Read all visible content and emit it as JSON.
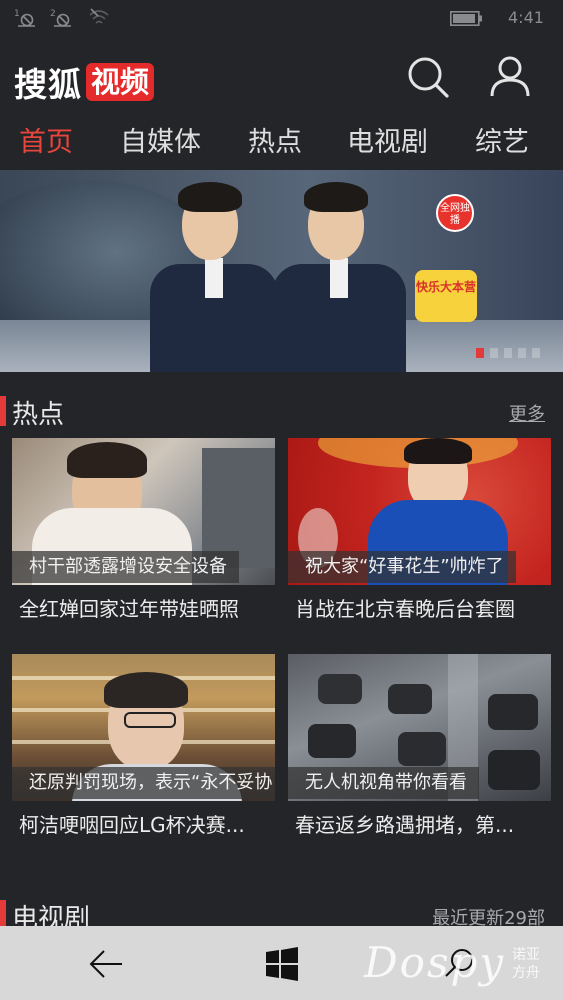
{
  "status_bar": {
    "sim1_label": "1",
    "sim2_label": "2",
    "time": "4:41"
  },
  "header": {
    "logo_text": "搜狐",
    "logo_badge": "视频",
    "search_icon": "search-icon",
    "user_icon": "user-icon"
  },
  "tabs": [
    {
      "label": "首页",
      "active": true
    },
    {
      "label": "自媒体",
      "active": false
    },
    {
      "label": "热点",
      "active": false
    },
    {
      "label": "电视剧",
      "active": false
    },
    {
      "label": "综艺",
      "active": false
    }
  ],
  "banner": {
    "badge_top": "全网独播",
    "badge_show": "快乐大本营",
    "dots_count": 5,
    "active_dot": 0
  },
  "hot_section": {
    "title": "热点",
    "more_label": "更多",
    "items": [
      {
        "overlay": "村干部透露增设安全设备",
        "title": "全红婵回家过年带娃晒照"
      },
      {
        "overlay": "祝大家“好事花生”帅炸了",
        "title": "肖战在北京春晚后台套圈"
      },
      {
        "overlay": "还原判罚现场，表示“永不妥协",
        "title": "柯洁哽咽回应LG杯决赛..."
      },
      {
        "overlay": "无人机视角带你看看",
        "title": "春运返乡路遇拥堵，第..."
      }
    ]
  },
  "tv_section": {
    "title": "电视剧",
    "more_label": "最近更新29部"
  },
  "bottom_nav": {
    "back_icon": "back-arrow-icon",
    "home_icon": "windows-logo-icon",
    "search_icon": "search-icon"
  },
  "watermark": {
    "text": "Dospy",
    "sub": "诺亚方舟"
  }
}
